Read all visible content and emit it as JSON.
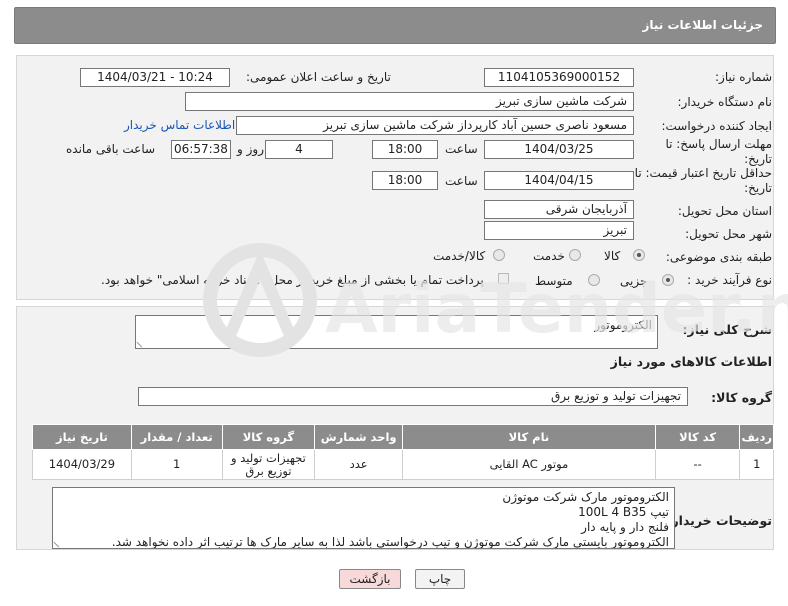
{
  "header": {
    "title": "جزئیات اطلاعات نیاز"
  },
  "form": {
    "need_number_label": "شماره نیاز:",
    "need_number": "1104105369000152",
    "announce_datetime_label": "تاریخ و ساعت اعلان عمومی:",
    "announce_datetime": "1404/03/21 - 10:24",
    "buyer_org_label": "نام دستگاه خریدار:",
    "buyer_org": "شرکت ماشین سازی تبریز",
    "requester_label": "ایجاد کننده درخواست:",
    "requester": "مسعود ناصری حسین آباد کارپرداز شرکت ماشین سازی تبریز",
    "buyer_contact_link": "اطلاعات تماس خریدار",
    "reply_deadline_label": "مهلت ارسال پاسخ: تا تاریخ:",
    "reply_date": "1404/03/25",
    "hour_label": "ساعت",
    "reply_time": "18:00",
    "days_value": "4",
    "days_and_label": "روز و",
    "remaining_time": "06:57:38",
    "remaining_label": "ساعت باقی مانده",
    "price_validity_label": "حداقل تاریخ اعتبار قیمت: تا تاریخ:",
    "validity_date": "1404/04/15",
    "validity_time": "18:00",
    "province_label": "استان محل تحویل:",
    "province": "آذربایجان شرقی",
    "city_label": "شهر محل تحویل:",
    "city": "تبریز",
    "category_label": "طبقه بندی موضوعی:",
    "category_options": [
      "کالا",
      "خدمت",
      "کالا/خدمت"
    ],
    "purchase_type_label": "نوع فرآیند خرید :",
    "purchase_options": [
      "جزیی",
      "متوسط"
    ],
    "payment_note": "پرداخت تمام یا بخشی از مبلغ خرید،از محل \"اسناد خزانه اسلامی\" خواهد بود."
  },
  "details": {
    "general_desc_label": "شرح کلی نیاز:",
    "general_desc": "الکتروموتور",
    "goods_info_title": "اطلاعات کالاهای مورد نیاز",
    "goods_group_label": "گروه کالا:",
    "goods_group": "تجهیزات تولید و توزیع برق",
    "table": {
      "headers": [
        "ردیف",
        "کد کالا",
        "نام کالا",
        "واحد شمارش",
        "گروه کالا",
        "تعداد / مقدار",
        "تاریخ نیاز"
      ],
      "rows": [
        [
          "1",
          "--",
          "موتور AC القایی",
          "عدد",
          "تجهیزات تولید و توزیع برق",
          "1",
          "1404/03/29"
        ]
      ]
    },
    "buyer_notes_label": "توضیحات خریدار:",
    "buyer_notes": [
      "الکتروموتور مارک شرکت موتوژن",
      "تیپ 100L 4 B35",
      "فلنج دار و پایه دار",
      "الکتروموتور بایستی مارک شرکت موتوژن و تیپ درخواستی باشد لذا به سایر مارک ها ترتیب اثر داده نخواهد شد."
    ]
  },
  "buttons": {
    "print": "چاپ",
    "back": "بازگشت"
  },
  "watermark_text": "AriaTender.net",
  "colors": {
    "header_bg": "#8c8c8c",
    "link": "#1a56b8",
    "back_btn": "#f8d9d9",
    "print_btn": "#f3f3f3"
  }
}
